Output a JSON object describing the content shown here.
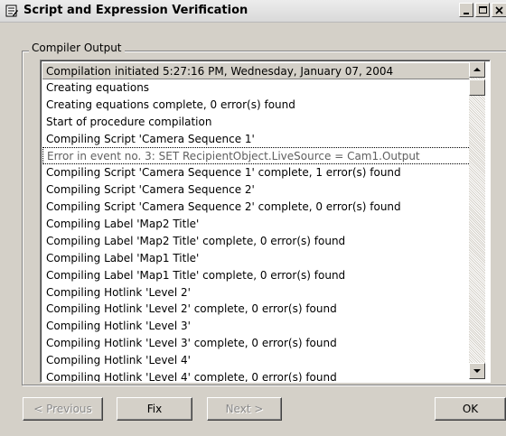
{
  "window": {
    "title": "Script and Expression Verification",
    "controls": {
      "minimize": "_",
      "maximize": "□",
      "close": "×"
    }
  },
  "group": {
    "label": "Compiler Output"
  },
  "log": {
    "selected_index": 0,
    "focused_index": 5,
    "entries": [
      "Compilation initiated 5:27:16 PM, Wednesday, January 07, 2004",
      "Creating equations",
      "Creating equations complete, 0 error(s) found",
      "Start of procedure compilation",
      "Compiling Script 'Camera Sequence 1'",
      "Error in event no. 3: SET RecipientObject.LiveSource = Cam1.Output",
      "Compiling Script 'Camera Sequence 1' complete, 1 error(s) found",
      "Compiling Script 'Camera Sequence 2'",
      "Compiling Script 'Camera Sequence 2' complete, 0 error(s) found",
      "Compiling Label 'Map2 Title'",
      "Compiling Label 'Map2 Title' complete, 0 error(s) found",
      "Compiling Label 'Map1 Title'",
      "Compiling Label 'Map1 Title' complete, 0 error(s) found",
      "Compiling Hotlink 'Level 2'",
      "Compiling Hotlink 'Level 2' complete, 0 error(s) found",
      "Compiling Hotlink 'Level 3'",
      "Compiling Hotlink 'Level 3' complete, 0 error(s) found",
      "Compiling Hotlink 'Level 4'",
      "Compiling Hotlink 'Level 4' complete, 0 error(s) found"
    ]
  },
  "buttons": {
    "previous": "< Previous",
    "fix": "Fix",
    "next": "Next >",
    "ok": "OK"
  },
  "colors": {
    "face": "#d4d0c8",
    "disabled_text": "#8a8a8a",
    "list_background": "#ffffff"
  }
}
